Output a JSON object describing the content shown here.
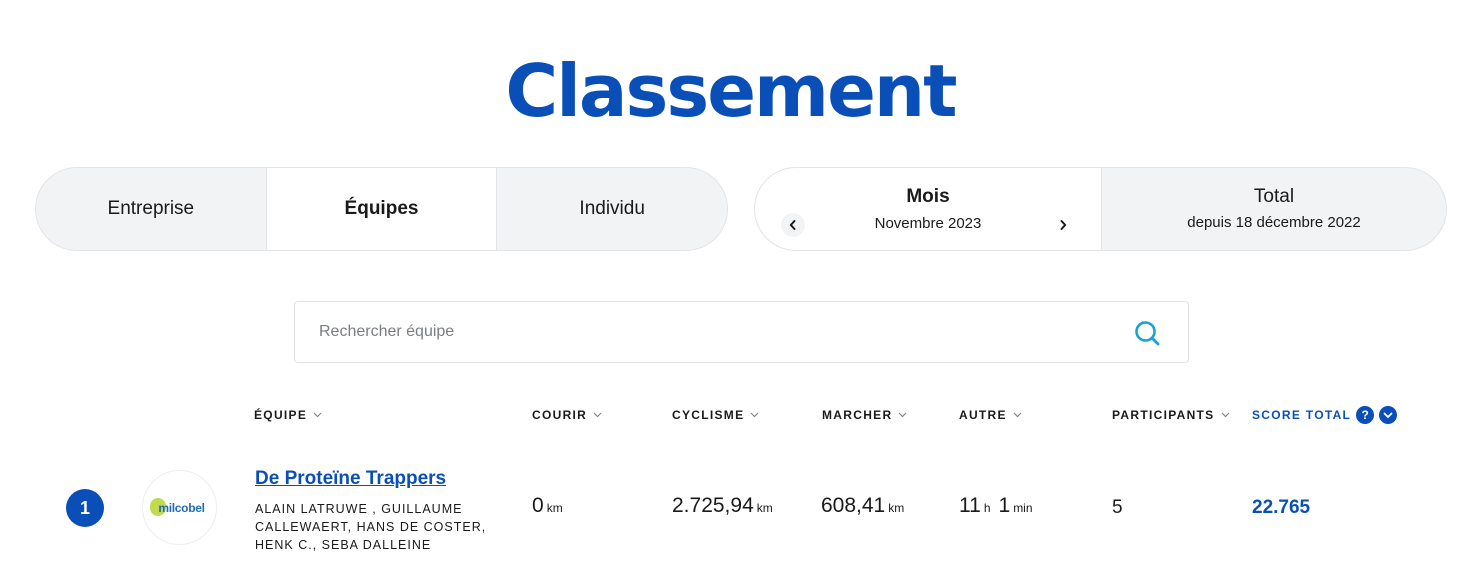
{
  "page": {
    "title": "Classement"
  },
  "type_tabs": [
    {
      "label": "Entreprise",
      "active": false
    },
    {
      "label": "Équipes",
      "active": true
    },
    {
      "label": "Individu",
      "active": false
    }
  ],
  "period": {
    "month_label": "Mois",
    "month_value": "Novembre 2023",
    "total_label": "Total",
    "total_value": "depuis 18 décembre 2022"
  },
  "search": {
    "placeholder": "Rechercher équipe"
  },
  "columns": {
    "team": "ÉQUIPE",
    "run": "COURIR",
    "cycling": "CYCLISME",
    "walk": "MARCHER",
    "other": "AUTRE",
    "participants": "PARTICIPANTS",
    "score": "SCORE TOTAL",
    "help": "?"
  },
  "rows": [
    {
      "rank": "1",
      "logo_text": "milcobel",
      "team_name": "De Proteïne Trappers",
      "members": "ALAIN LATRUWE , GUILLAUME CALLEWAERT, HANS DE COSTER, HENK C., SEBA DALLEINE",
      "run_value": "0",
      "run_unit": "km",
      "cycling_value": "2.725,94",
      "cycling_unit": "km",
      "walk_value": "608,41",
      "walk_unit": "km",
      "other_hours": "11",
      "other_hours_unit": "h",
      "other_minutes": "1",
      "other_minutes_unit": "min",
      "participants": "5",
      "score": "22.765"
    }
  ],
  "colors": {
    "accent": "#0a4fb8",
    "search_icon": "#1aa3d1",
    "segment_bg": "#f2f3f5"
  },
  "icons": {
    "search": "search-icon",
    "prev": "chevron-left-icon",
    "next": "chevron-right-icon",
    "sort": "chevron-down-icon",
    "help": "question-icon"
  }
}
